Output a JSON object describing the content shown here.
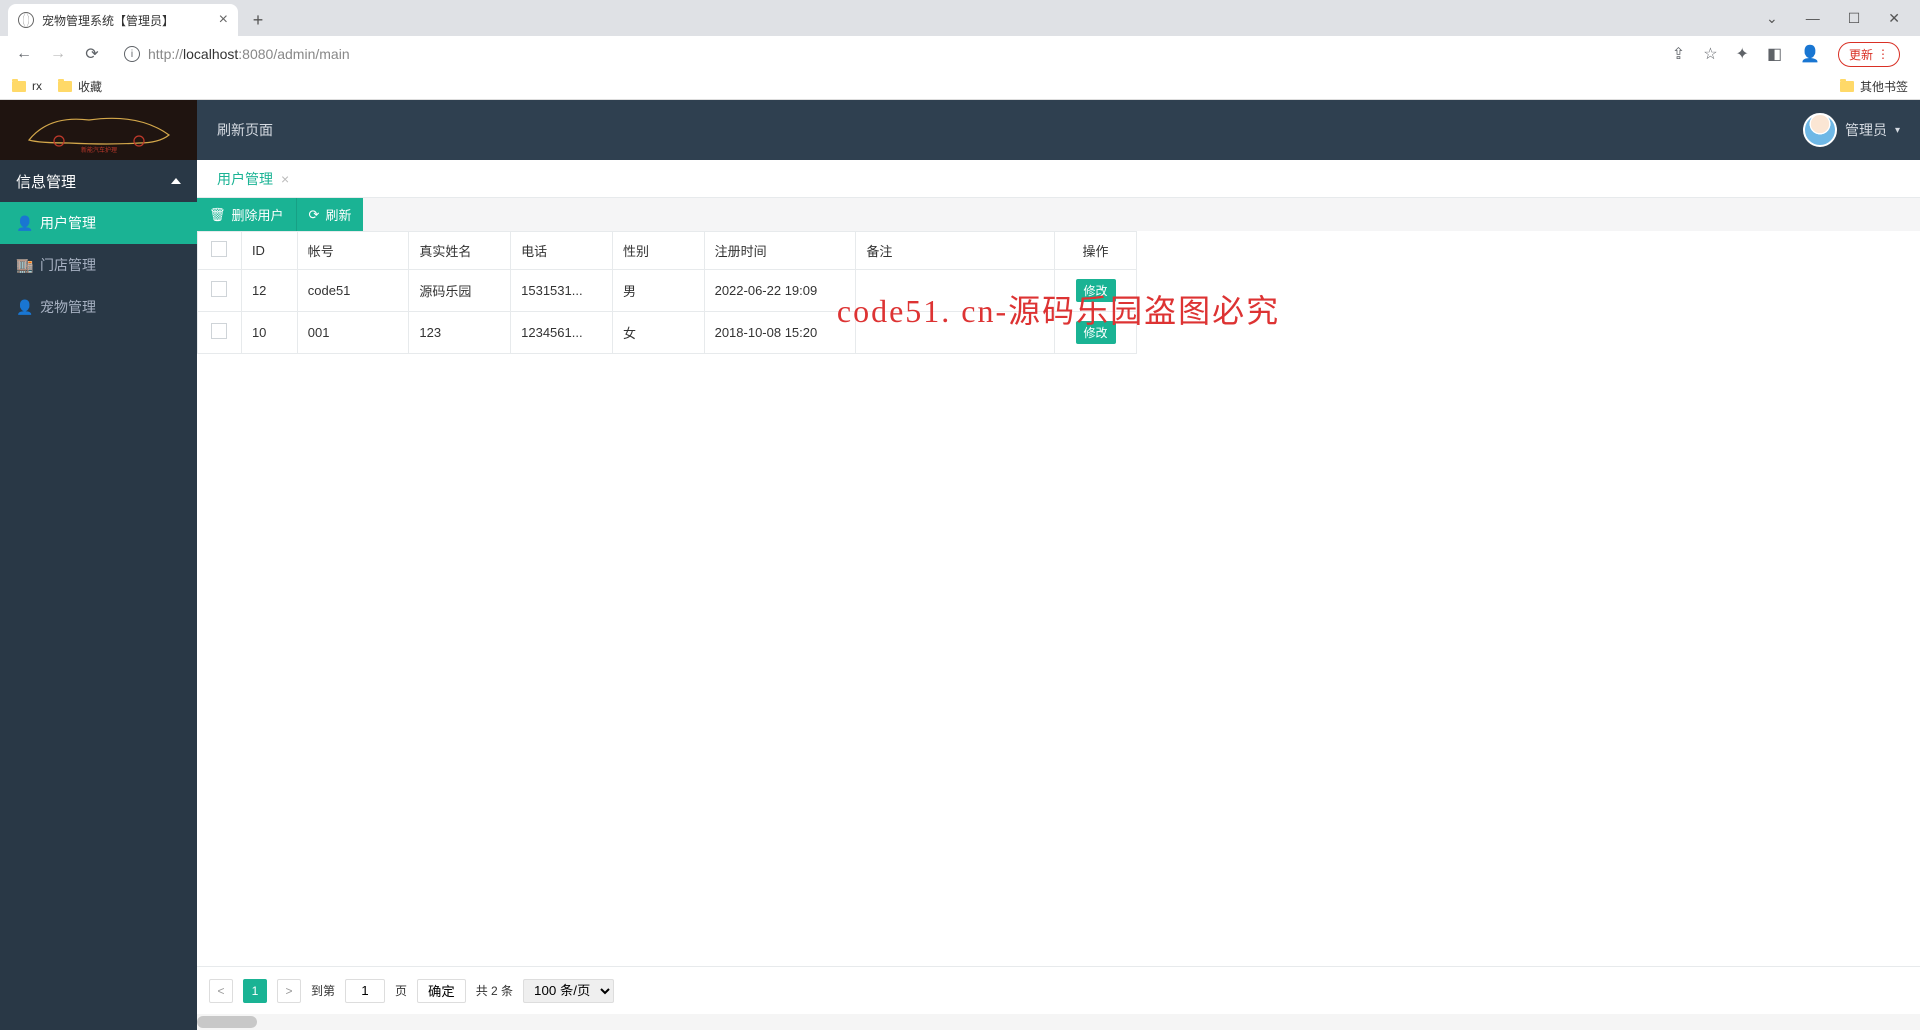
{
  "browser": {
    "tab_title": "宠物管理系统【管理员】",
    "url_host": "localhost",
    "url_port": ":8080",
    "url_path": "/admin/main",
    "url_prefix": "http://",
    "update_label": "更新",
    "bookmarks": [
      "rx",
      "收藏"
    ],
    "other_bookmarks": "其他书签"
  },
  "sidebar": {
    "header": "信息管理",
    "items": [
      {
        "icon": "👤",
        "label": "用户管理"
      },
      {
        "icon": "🏬",
        "label": "门店管理"
      },
      {
        "icon": "👤",
        "label": "宠物管理"
      }
    ]
  },
  "topbar": {
    "refresh": "刷新页面",
    "user_label": "管理员"
  },
  "tabs_row": {
    "active": "用户管理"
  },
  "toolbar": {
    "delete_label": "删除用户",
    "refresh_label": "刷新"
  },
  "table": {
    "headers": [
      "ID",
      "帐号",
      "真实姓名",
      "电话",
      "性别",
      "注册时间",
      "备注",
      "操作"
    ],
    "rows": [
      {
        "id": "12",
        "account": "code51",
        "name": "源码乐园",
        "tel": "1531531...",
        "sex": "男",
        "time": "2022-06-22 19:09",
        "note": "",
        "edit": "修改"
      },
      {
        "id": "10",
        "account": "001",
        "name": "123",
        "tel": "1234561...",
        "sex": "女",
        "time": "2018-10-08 15:20",
        "note": "",
        "edit": "修改"
      }
    ]
  },
  "watermark": "code51. cn-源码乐园盗图必究",
  "pager": {
    "current": "1",
    "goto_label": "到第",
    "goto_value": "1",
    "page_word": "页",
    "confirm": "确定",
    "total": "共 2 条",
    "per_page": "100 条/页"
  }
}
